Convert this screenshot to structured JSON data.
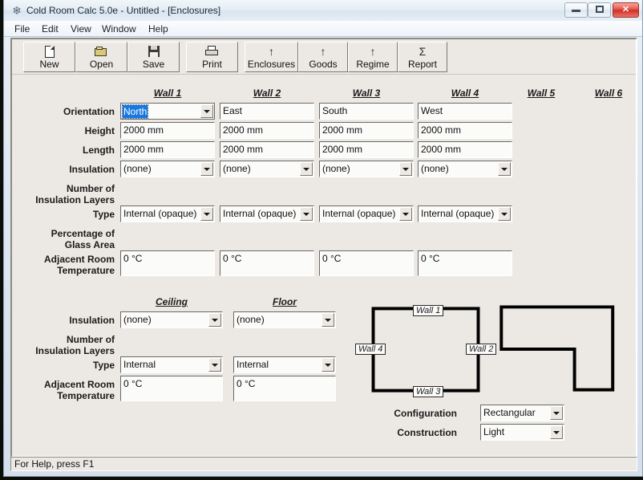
{
  "window": {
    "title": "Cold Room Calc 5.0e - Untitled - [Enclosures]",
    "app_icon": "snowflake-icon",
    "buttons": {
      "minimize": "minimize-icon",
      "maximize": "maximize-icon",
      "close": "✕"
    }
  },
  "menubar": {
    "items": [
      {
        "label": "File"
      },
      {
        "label": "Edit"
      },
      {
        "label": "View"
      },
      {
        "label": "Window"
      },
      {
        "label": "Help"
      }
    ]
  },
  "toolbar": {
    "buttons": [
      {
        "label": "New",
        "icon": "new-document-icon"
      },
      {
        "label": "Open",
        "icon": "open-folder-icon"
      },
      {
        "label": "Save",
        "icon": "floppy-disk-icon"
      },
      {
        "label": "Print",
        "icon": "printer-icon"
      },
      {
        "label": "Enclosures",
        "icon": "up-arrow-icon",
        "glyph": "↑"
      },
      {
        "label": "Goods",
        "icon": "up-arrow-icon",
        "glyph": "↑"
      },
      {
        "label": "Regime",
        "icon": "up-arrow-icon",
        "glyph": "↑"
      },
      {
        "label": "Report",
        "icon": "sigma-icon",
        "glyph": "Σ"
      }
    ]
  },
  "walls": {
    "headers": [
      "Wall 1",
      "Wall 2",
      "Wall 3",
      "Wall 4",
      "Wall 5",
      "Wall 6"
    ],
    "row_labels": {
      "orientation": "Orientation",
      "height": "Height",
      "length": "Length",
      "insulation": "Insulation",
      "layers_line1": "Number of",
      "layers_line2": "Insulation Layers",
      "type": "Type",
      "glass_line1": "Percentage of",
      "glass_line2": "Glass Area",
      "adjacent_line1": "Adjacent Room",
      "adjacent_line2": "Temperature"
    },
    "columns": [
      {
        "name": "Wall 1",
        "orientation": "North",
        "orientation_focused": true,
        "height": "2000 mm",
        "length": "2000 mm",
        "insulation": "(none)",
        "type": "Internal (opaque)",
        "adjacent_temperature": "0 °C"
      },
      {
        "name": "Wall 2",
        "orientation": "East",
        "orientation_focused": false,
        "height": "2000 mm",
        "length": "2000 mm",
        "insulation": "(none)",
        "type": "Internal (opaque)",
        "adjacent_temperature": "0 °C"
      },
      {
        "name": "Wall 3",
        "orientation": "South",
        "orientation_focused": false,
        "height": "2000 mm",
        "length": "2000 mm",
        "insulation": "(none)",
        "type": "Internal (opaque)",
        "adjacent_temperature": "0 °C"
      },
      {
        "name": "Wall 4",
        "orientation": "West",
        "orientation_focused": false,
        "height": "2000 mm",
        "length": "2000 mm",
        "insulation": "(none)",
        "type": "Internal (opaque)",
        "adjacent_temperature": "0 °C"
      }
    ]
  },
  "surfaces": {
    "headers": [
      "Ceiling",
      "Floor"
    ],
    "row_labels": {
      "insulation": "Insulation",
      "layers_line1": "Number of",
      "layers_line2": "Insulation Layers",
      "type": "Type",
      "adjacent_line1": "Adjacent Room",
      "adjacent_line2": "Temperature"
    },
    "columns": [
      {
        "name": "Ceiling",
        "insulation": "(none)",
        "type": "Internal",
        "adjacent_temperature": "0 °C"
      },
      {
        "name": "Floor",
        "insulation": "(none)",
        "type": "Internal",
        "adjacent_temperature": "0 °C"
      }
    ]
  },
  "diagram": {
    "wall_labels": [
      "Wall 1",
      "Wall 2",
      "Wall 3",
      "Wall 4"
    ]
  },
  "shape_options": {
    "configuration_label": "Configuration",
    "configuration_value": "Rectangular",
    "construction_label": "Construction",
    "construction_value": "Light"
  },
  "statusbar": {
    "text": "For Help, press F1"
  },
  "colors": {
    "face": "#ece9e4",
    "field": "#fbfbfa",
    "selection": "#1978e0",
    "close_button": "#cf2e24"
  }
}
